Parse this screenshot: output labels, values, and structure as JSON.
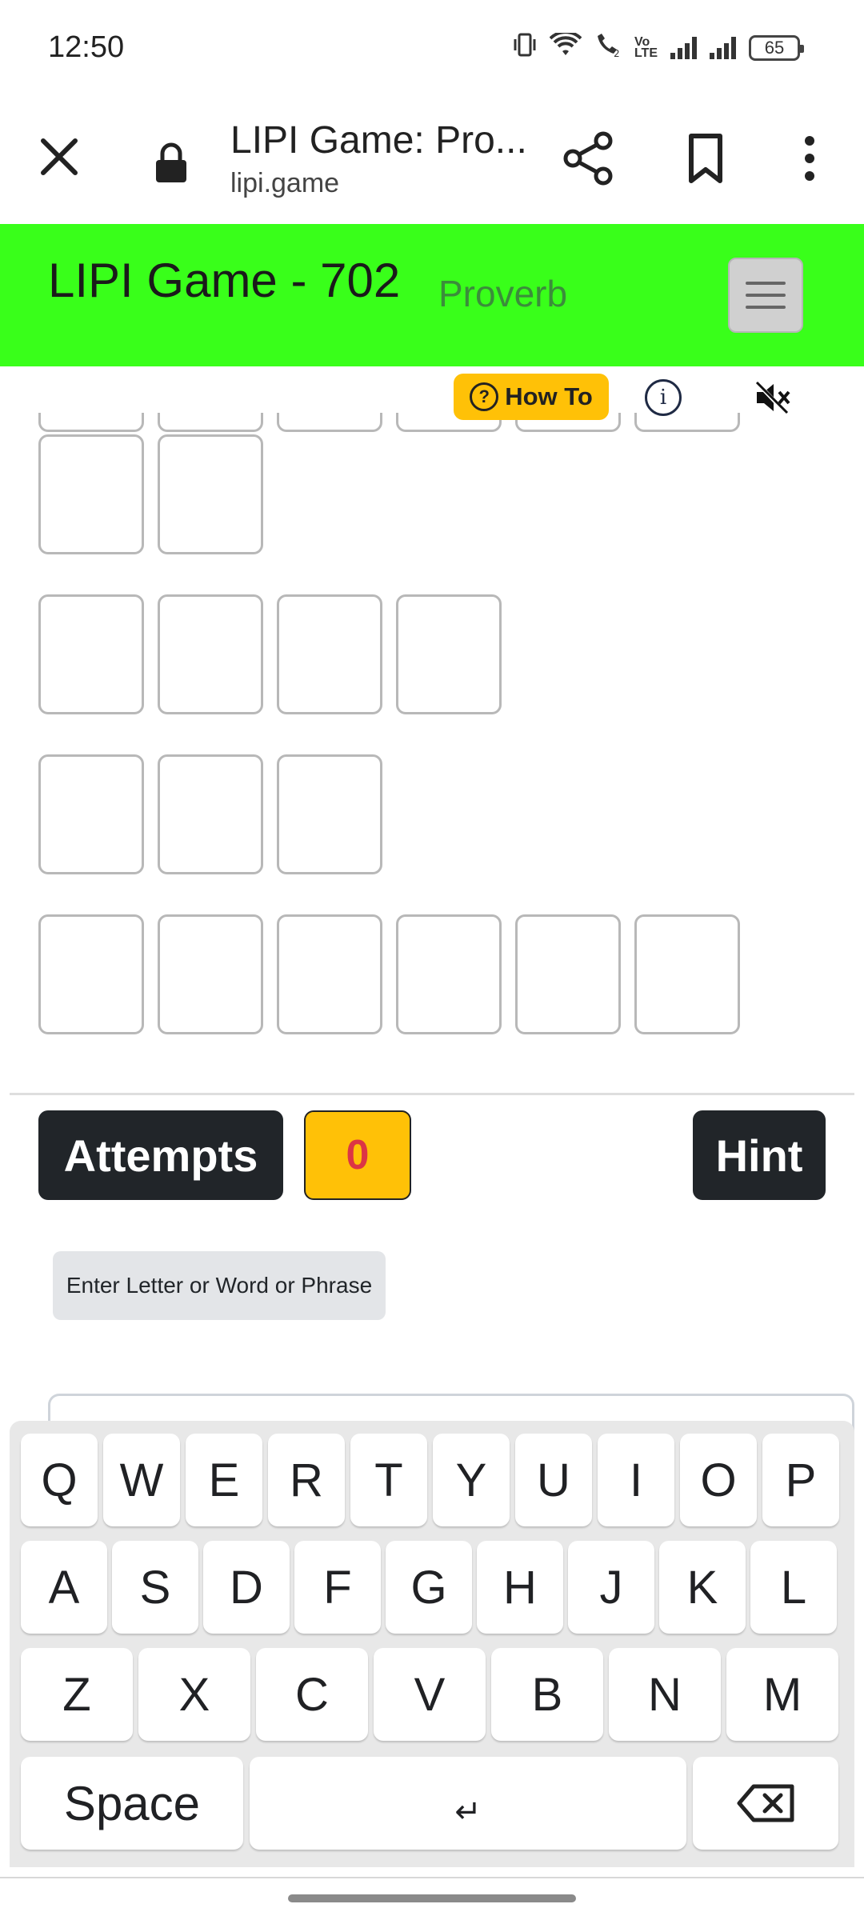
{
  "status_bar": {
    "time": "12:50",
    "battery": "65",
    "icons": [
      "vibrate-icon",
      "wifi-icon",
      "wifi-calling-icon",
      "volte-icon",
      "signal-icon",
      "signal-icon",
      "battery-icon"
    ]
  },
  "browser": {
    "title": "LIPI Game: Pro...",
    "url": "lipi.game",
    "icons": [
      "close-icon",
      "lock-icon",
      "share-icon",
      "bookmark-icon",
      "more-vert-icon"
    ]
  },
  "header": {
    "title": "LIPI Game - 702",
    "category": "Proverb",
    "accent": "#39ff1a"
  },
  "tools": {
    "how_to_label": "How To",
    "info_glyph": "i",
    "sound_state": "muted"
  },
  "puzzle": {
    "word_lengths": [
      2,
      4,
      3,
      6
    ],
    "letters": []
  },
  "controls": {
    "attempts_label": "Attempts",
    "attempts_count": "0",
    "hint_label": "Hint",
    "entry_label": "Enter Letter or Word or Phrase"
  },
  "keyboard": {
    "row1": [
      "Q",
      "W",
      "E",
      "R",
      "T",
      "Y",
      "U",
      "I",
      "O",
      "P"
    ],
    "row2": [
      "A",
      "S",
      "D",
      "F",
      "G",
      "H",
      "J",
      "K",
      "L"
    ],
    "row3": [
      "Z",
      "X",
      "C",
      "V",
      "B",
      "N",
      "M"
    ],
    "space_label": "Space",
    "enter_glyph": "↵"
  },
  "colors": {
    "dark_button": "#212529",
    "counter_bg": "#ffc107",
    "counter_text": "#dc3545"
  }
}
